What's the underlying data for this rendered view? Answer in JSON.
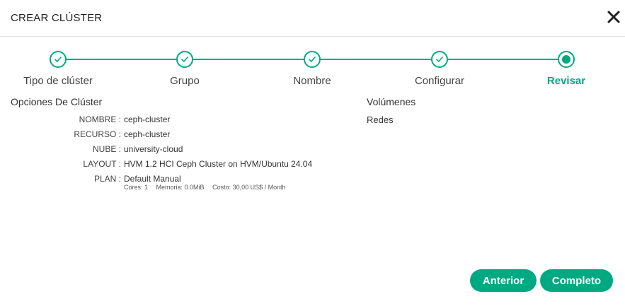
{
  "dialog": {
    "title": "CREAR CLÚSTER"
  },
  "steps": [
    {
      "label": "Tipo de clúster",
      "state": "done"
    },
    {
      "label": "Grupo",
      "state": "done"
    },
    {
      "label": "Nombre",
      "state": "done"
    },
    {
      "label": "Configurar",
      "state": "done"
    },
    {
      "label": "Revisar",
      "state": "active"
    }
  ],
  "review": {
    "options_title": "Opciones De Clúster",
    "rows": [
      {
        "label": "NOMBRE :",
        "value": "ceph-cluster"
      },
      {
        "label": "RECURSO :",
        "value": "ceph-cluster"
      },
      {
        "label": "NUBE :",
        "value": "university-cloud"
      },
      {
        "label": "LAYOUT :",
        "value": "HVM 1.2 HCI Ceph Cluster on HVM/Ubuntu 24.04"
      },
      {
        "label": "PLAN :",
        "value": "Default Manual"
      }
    ],
    "plan_meta": {
      "cores": "Cores: 1",
      "memory": "Memoria: 0.0MiB",
      "cost": "Costo: 30,00 US$ / Month"
    },
    "volumes_title": "Volúmenes",
    "networks_title": "Redes"
  },
  "buttons": {
    "previous": "Anterior",
    "complete": "Completo"
  },
  "colors": {
    "accent": "#01a982"
  }
}
